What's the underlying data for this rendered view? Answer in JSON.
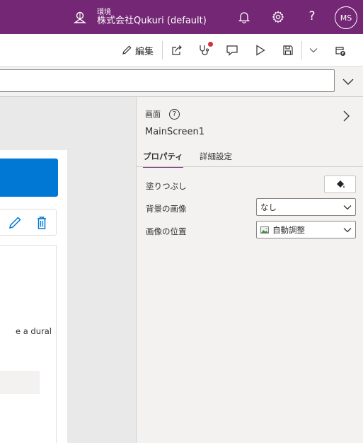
{
  "header": {
    "environment_label": "環境",
    "environment_name": "株式会社Qukuri (default)",
    "help_glyph": "?",
    "avatar_initials": "MS",
    "color": "#742774"
  },
  "toolbar": {
    "edit_label": "編集"
  },
  "canvas": {
    "snippet_text": "e a dural",
    "accent_color": "#0078d4",
    "delete_color": "#0078d4"
  },
  "panel": {
    "type_label": "画面",
    "help_glyph": "?",
    "screen_name": "MainScreen1",
    "tabs": [
      {
        "label": "プロパティ",
        "active": true
      },
      {
        "label": "詳細設定",
        "active": false
      }
    ],
    "properties": {
      "fill_label": "塗りつぶし",
      "background_image_label": "背景の画像",
      "background_image_value": "なし",
      "image_position_label": "画像の位置",
      "image_position_value": "自動調整"
    }
  },
  "icons": [
    "environment-icon",
    "bell-icon",
    "gear-icon",
    "help-icon",
    "pencil-icon",
    "share-icon",
    "app-checker-icon",
    "comment-icon",
    "play-icon",
    "save-icon",
    "chevron-down-icon",
    "publish-icon",
    "delete-icon",
    "paint-bucket-icon",
    "image-icon",
    "chevron-right-icon"
  ]
}
